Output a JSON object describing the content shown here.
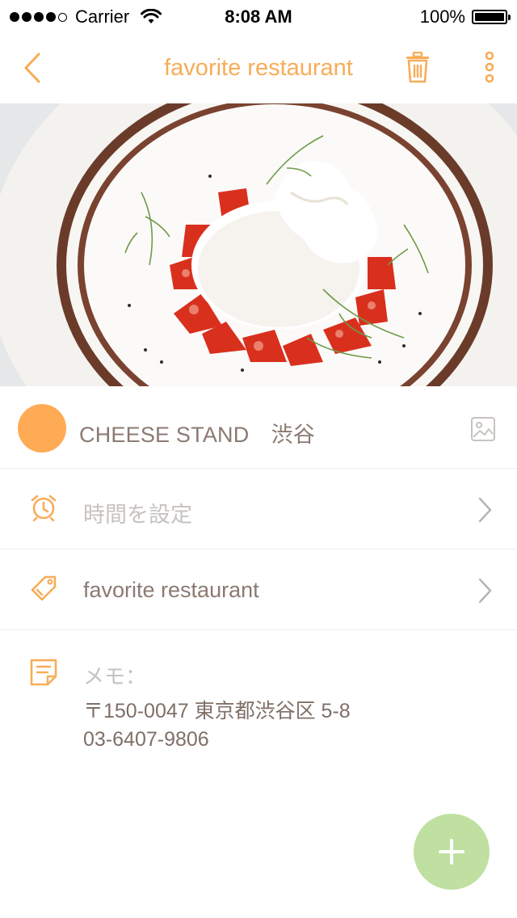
{
  "status_bar": {
    "carrier": "Carrier",
    "time": "8:08 AM",
    "battery": "100%"
  },
  "nav": {
    "title": "favorite restaurant"
  },
  "place": {
    "name": "CHEESE STAND　渋谷"
  },
  "time_row": {
    "label": "時間を設定"
  },
  "tag_row": {
    "label": "favorite restaurant"
  },
  "memo": {
    "label": "メモ：",
    "lines": [
      "〒150-0047 東京都渋谷区 5-8",
      "03-6407-9806"
    ]
  },
  "colors": {
    "accent": "#f8ac57",
    "avatar": "#ffab56",
    "fab": "#bfe0a0"
  }
}
